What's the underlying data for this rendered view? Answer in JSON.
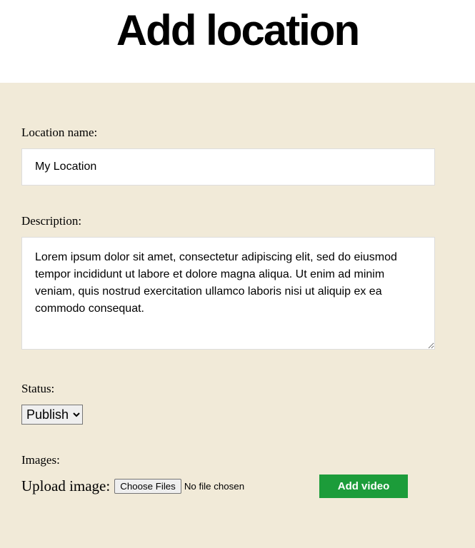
{
  "page": {
    "title": "Add location"
  },
  "form": {
    "location_name": {
      "label": "Location name:",
      "value": "My Location"
    },
    "description": {
      "label": "Description:",
      "value": "Lorem ipsum dolor sit amet, consectetur adipiscing elit, sed do eiusmod tempor incididunt ut labore et dolore magna aliqua. Ut enim ad minim veniam, quis nostrud exercitation ullamco laboris nisi ut aliquip ex ea commodo consequat."
    },
    "status": {
      "label": "Status:",
      "selected": "Publish"
    },
    "images": {
      "label": "Images:",
      "upload_label": "Upload image:",
      "choose_button": "Choose Files",
      "no_file_text": "No file chosen",
      "add_video_button": "Add video"
    }
  }
}
